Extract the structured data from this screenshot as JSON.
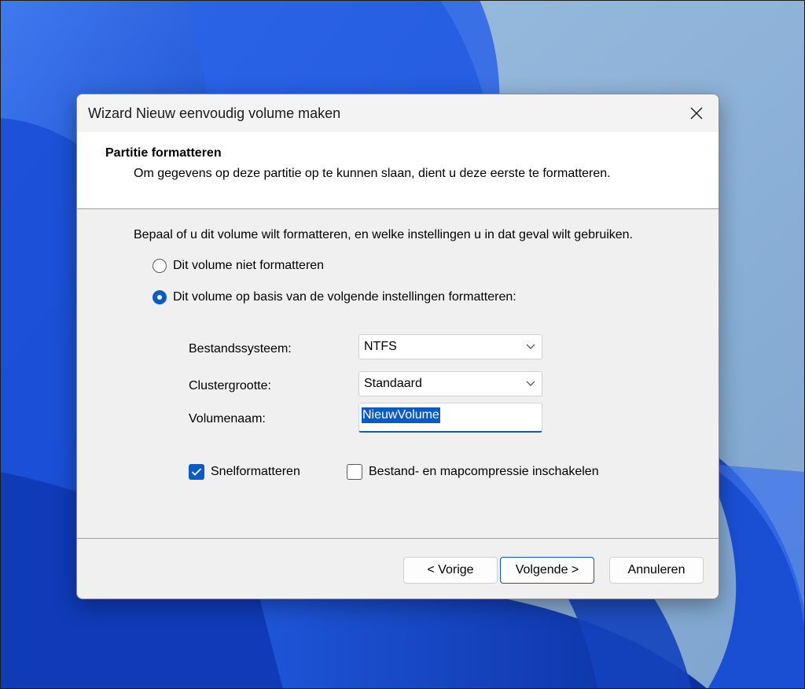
{
  "window": {
    "title": "Wizard Nieuw eenvoudig volume maken",
    "close_icon": "close-icon"
  },
  "header": {
    "title": "Partitie formatteren",
    "description": "Om gegevens op deze partitie op te kunnen slaan, dient u deze eerste te formatteren."
  },
  "main": {
    "instruction": "Bepaal of u dit volume wilt formatteren, en welke instellingen u in dat geval wilt gebruiken.",
    "options": [
      {
        "label": "Dit volume niet formatteren",
        "selected": false
      },
      {
        "label": "Dit volume op basis van de volgende instellingen formatteren:",
        "selected": true
      }
    ],
    "filesystem": {
      "label": "Bestandssysteem:",
      "value": "NTFS"
    },
    "cluster_size": {
      "label": "Clustergrootte:",
      "value": "Standaard"
    },
    "volume_name": {
      "label": "Volumenaam:",
      "value": "NieuwVolume"
    },
    "quick_format": {
      "label": "Snelformatteren",
      "checked": true
    },
    "compression": {
      "label": "Bestand- en mapcompressie inschakelen",
      "checked": false
    }
  },
  "footer": {
    "back_label": "< Vorige",
    "next_label": "Volgende >",
    "cancel_label": "Annuleren"
  },
  "colors": {
    "accent": "#0a5bc4",
    "dialog_background": "#f0f0f0",
    "header_background": "#ffffff"
  }
}
